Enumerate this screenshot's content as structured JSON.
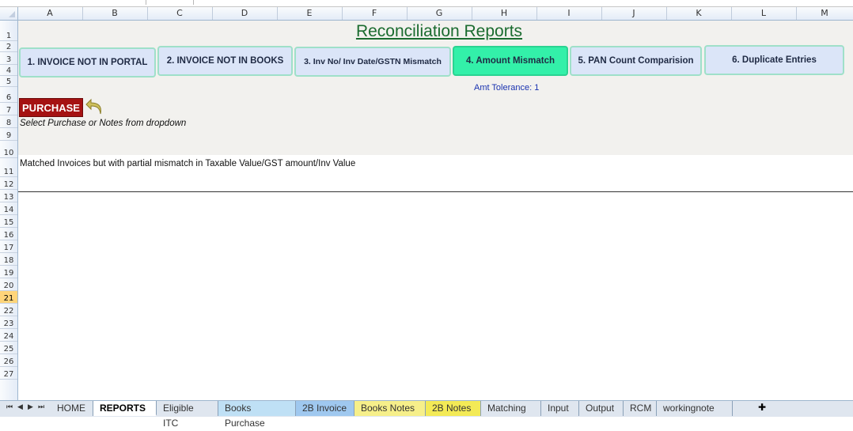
{
  "columns": [
    "A",
    "B",
    "C",
    "D",
    "E",
    "F",
    "G",
    "H",
    "I",
    "J",
    "K",
    "L",
    "M"
  ],
  "rows": [
    "1",
    "2",
    "3",
    "4",
    "5",
    "6",
    "7",
    "8",
    "9",
    "10",
    "11",
    "12",
    "13",
    "14",
    "15",
    "16",
    "17",
    "18",
    "19",
    "20",
    "21",
    "22",
    "23",
    "24",
    "25",
    "26",
    "27"
  ],
  "selected_row": "21",
  "title": "Reconciliation Reports",
  "buttons": [
    {
      "label": "1. INVOICE NOT IN PORTAL"
    },
    {
      "label": "2. INVOICE NOT IN BOOKS"
    },
    {
      "label": "3. Inv No/ Inv Date/GSTN Mismatch"
    },
    {
      "label": "4. Amount Mismatch"
    },
    {
      "label": "5. PAN Count Comparision"
    },
    {
      "label": "6. Duplicate Entries"
    }
  ],
  "tolerance": "Amt Tolerance: 1",
  "dropdown_value": "PURCHASE",
  "hint": "Select Purchase or Notes from dropdown",
  "message": "Matched Invoices but with partial mismatch in Taxable Value/GST amount/Inv Value",
  "sheet_tabs": [
    {
      "label": "HOME",
      "color": "#dfe6ef"
    },
    {
      "label": "REPORTS",
      "color": "#ffffff"
    },
    {
      "label": "Eligible ITC",
      "color": "#dfe6ef"
    },
    {
      "label": "Books Purchase",
      "color": "#bfe0f5"
    },
    {
      "label": "2B Invoice",
      "color": "#9fc8ef"
    },
    {
      "label": "Books Notes",
      "color": "#f6ef8a"
    },
    {
      "label": "2B Notes",
      "color": "#f3ea56"
    },
    {
      "label": "Matching",
      "color": "#dfe6ef"
    },
    {
      "label": "Input",
      "color": "#dfe6ef"
    },
    {
      "label": "Output",
      "color": "#dfe6ef"
    },
    {
      "label": "RCM",
      "color": "#dfe6ef"
    },
    {
      "label": "workingnote",
      "color": "#dfe6ef"
    }
  ],
  "nav_icons": [
    "first-sheet-icon",
    "prev-sheet-icon",
    "next-sheet-icon",
    "last-sheet-icon"
  ]
}
